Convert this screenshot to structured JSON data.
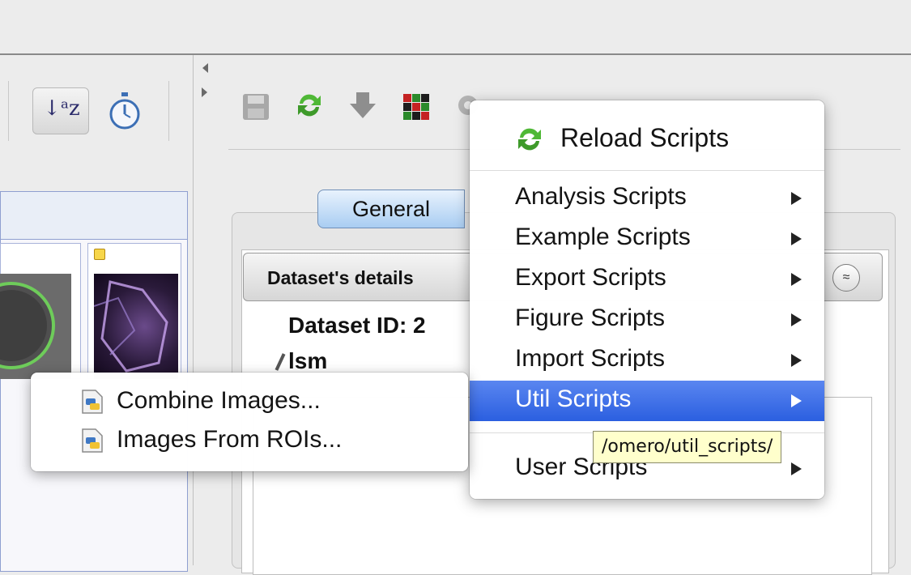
{
  "main": {
    "tab_general": "General",
    "details_title": "Dataset's details",
    "dataset_id": "Dataset ID: 2",
    "dataset_name": "lsm",
    "collapse_glyph": "≈"
  },
  "scripts_menu": {
    "reload_label": "Reload Scripts",
    "items": [
      {
        "label": "Analysis Scripts",
        "highlighted": false
      },
      {
        "label": "Example Scripts",
        "highlighted": false
      },
      {
        "label": "Export Scripts",
        "highlighted": false
      },
      {
        "label": "Figure Scripts",
        "highlighted": false
      },
      {
        "label": "Import Scripts",
        "highlighted": false
      },
      {
        "label": "Util Scripts",
        "highlighted": true
      },
      {
        "label": "User Scripts",
        "highlighted": false
      }
    ],
    "tooltip": "/omero/util_scripts/"
  },
  "util_submenu": {
    "items": [
      {
        "label": "Combine Images...",
        "icon": "python-script-icon"
      },
      {
        "label": "Images From ROIs...",
        "icon": "python-script-icon"
      }
    ]
  },
  "colors": {
    "highlight": "#2b5fe0",
    "tab_active": "#a9cdf2",
    "tooltip_bg": "#ffffcc"
  }
}
